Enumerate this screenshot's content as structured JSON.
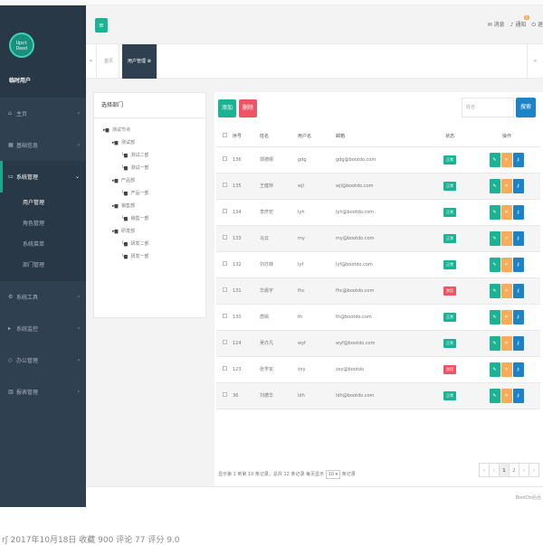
{
  "sidebar": {
    "avatar_text": "Upot Deed",
    "user_name": "临时用户",
    "items": [
      {
        "label": "主页",
        "icon": "home-icon",
        "glyph": "⌂",
        "active": false
      },
      {
        "label": "基础信息",
        "icon": "grid-icon",
        "glyph": "▦",
        "active": false
      },
      {
        "label": "系统管理",
        "icon": "desktop-icon",
        "glyph": "▭",
        "active": true
      },
      {
        "label": "系统工具",
        "icon": "gear-icon",
        "glyph": "⚙",
        "active": false
      },
      {
        "label": "系统监控",
        "icon": "video-icon",
        "glyph": "▸",
        "active": false
      },
      {
        "label": "办公管理",
        "icon": "cube-icon",
        "glyph": "◇",
        "active": false
      },
      {
        "label": "报表管理",
        "icon": "chart-icon",
        "glyph": "▥",
        "active": false
      }
    ],
    "submenu": [
      "用户管理",
      "角色管理",
      "系统菜单",
      "部门管理"
    ],
    "submenu_current": "用户管理"
  },
  "topbar": {
    "right": [
      {
        "label": "消息",
        "icon": "message-icon",
        "glyph": "✉"
      },
      {
        "label": "通知",
        "icon": "bell-icon",
        "glyph": "♪",
        "badge": "1"
      },
      {
        "label": "退",
        "icon": "signout-icon",
        "glyph": "⏻"
      }
    ]
  },
  "tabs": {
    "prev": "«",
    "next": "»",
    "items": [
      {
        "label": "首页",
        "active": false
      },
      {
        "label": "用户管理 ⊗",
        "active": true
      }
    ]
  },
  "dept": {
    "title": "选择部门",
    "tree": [
      {
        "label": "测试节点",
        "level": 0
      },
      {
        "label": "测试部",
        "level": 1
      },
      {
        "label": "测试二部",
        "level": 2
      },
      {
        "label": "测试一部",
        "level": 2
      },
      {
        "label": "产品部",
        "level": 1
      },
      {
        "label": "产品一部",
        "level": 2
      },
      {
        "label": "销售部",
        "level": 1
      },
      {
        "label": "销售一部",
        "level": 2
      },
      {
        "label": "研发部",
        "level": 1
      },
      {
        "label": "研发二部",
        "level": 2
      },
      {
        "label": "研发一部",
        "level": 2
      }
    ]
  },
  "toolbar": {
    "add_label": "添加",
    "delete_label": "删除",
    "search_placeholder": "姓名",
    "search_label": "搜索"
  },
  "table": {
    "columns": [
      "",
      "序号",
      "姓名",
      "用户名",
      "邮箱",
      "状态",
      "操作"
    ],
    "rows": [
      {
        "id": "136",
        "name": "郭德纲",
        "username": "gdg",
        "email": "gdg@bootdo.com",
        "status": "正常"
      },
      {
        "id": "135",
        "name": "王健林",
        "username": "wjl",
        "email": "wjl@bootdo.com",
        "status": "正常"
      },
      {
        "id": "134",
        "name": "李彦宏",
        "username": "lyh",
        "email": "lyh@bootdo.com",
        "status": "正常"
      },
      {
        "id": "133",
        "name": "马云",
        "username": "my",
        "email": "my@bootdo.com",
        "status": "正常"
      },
      {
        "id": "132",
        "name": "刘亦菲",
        "username": "lyf",
        "email": "lyf@bootdo.com",
        "status": "正常"
      },
      {
        "id": "131",
        "name": "华晨宇",
        "username": "fhc",
        "email": "fhc@bootdo.com",
        "status": "禁用"
      },
      {
        "id": "130",
        "name": "唐嫣",
        "username": "th",
        "email": "th@bootdo.com",
        "status": "正常"
      },
      {
        "id": "124",
        "name": "吴亦凡",
        "username": "wyf",
        "email": "wyf@bootdo.com",
        "status": "正常"
      },
      {
        "id": "123",
        "name": "张学友",
        "username": "zxy",
        "email": "zxy@bootdo",
        "status": "禁用"
      },
      {
        "id": "36",
        "name": "刘德华",
        "username": "ldh",
        "email": "ldh@bootdo.com",
        "status": "正常"
      }
    ],
    "op_icons": {
      "edit": "✎",
      "delete": "✕",
      "key": "⚷"
    }
  },
  "pagination": {
    "info": "显示第 1 到第 10 条记录，总共 12 条记录 每页显示",
    "page_size": "10 ▾",
    "suffix": "条记录",
    "pages": [
      "‹",
      "‹",
      "1",
      "2",
      "›",
      "›"
    ],
    "current": "1"
  },
  "footer": {
    "text": "BootDo后台"
  },
  "caption": "rʃ 2017年10月18日    收藏 900    评论 77    评分 9.0",
  "colors": {
    "sidebar_bg": "#2f4050",
    "primary": "#1ab394",
    "danger": "#ed5565",
    "warning": "#f8ac59",
    "info": "#1c84c6"
  }
}
